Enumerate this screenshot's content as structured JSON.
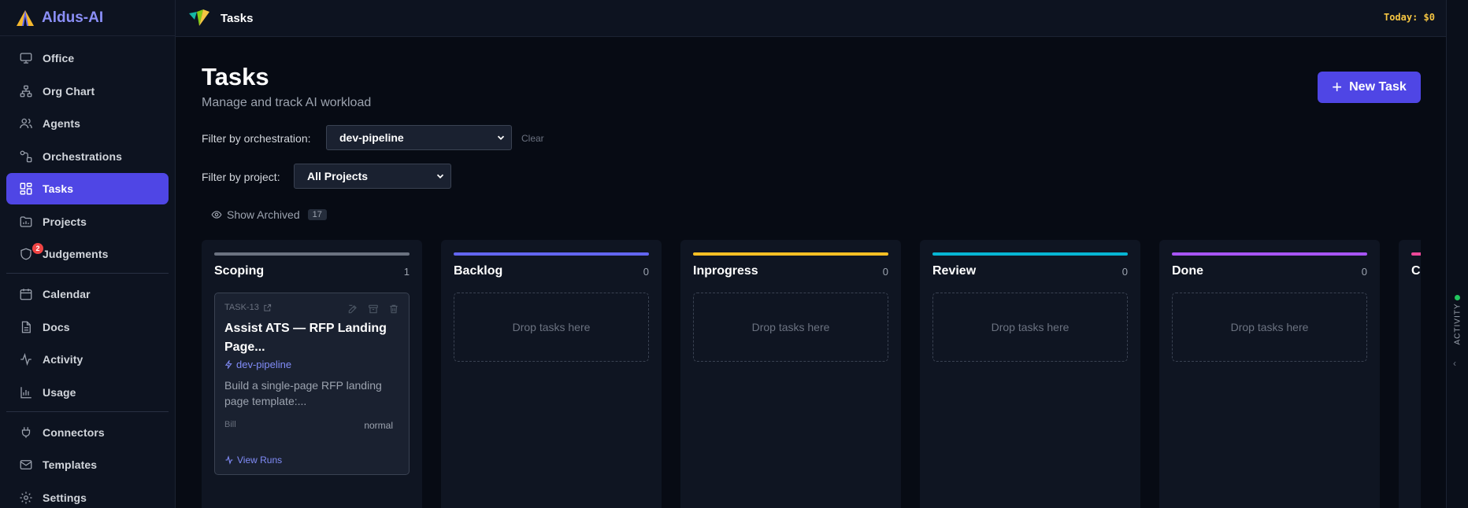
{
  "app": {
    "name": "Aldus-AI"
  },
  "sidebar": {
    "items": [
      {
        "label": "Office",
        "icon": "monitor-icon"
      },
      {
        "label": "Org Chart",
        "icon": "org-chart-icon"
      },
      {
        "label": "Agents",
        "icon": "users-icon"
      },
      {
        "label": "Orchestrations",
        "icon": "workflow-icon"
      },
      {
        "label": "Tasks",
        "icon": "grid-icon",
        "active": true
      },
      {
        "label": "Projects",
        "icon": "folder-chart-icon"
      },
      {
        "label": "Judgements",
        "icon": "shield-icon",
        "badge": "2"
      },
      {
        "label": "Calendar",
        "icon": "calendar-icon"
      },
      {
        "label": "Docs",
        "icon": "document-icon"
      },
      {
        "label": "Activity",
        "icon": "activity-icon"
      },
      {
        "label": "Usage",
        "icon": "bar-chart-icon"
      },
      {
        "label": "Connectors",
        "icon": "plug-icon"
      },
      {
        "label": "Templates",
        "icon": "mail-icon"
      },
      {
        "label": "Settings",
        "icon": "gear-icon"
      }
    ]
  },
  "topbar": {
    "title": "Tasks",
    "today": "Today: $0"
  },
  "page": {
    "title": "Tasks",
    "subtitle": "Manage and track AI workload",
    "new_task_label": "New Task"
  },
  "filters": {
    "orchestration_label": "Filter by orchestration:",
    "orchestration_value": "dev-pipeline",
    "clear_label": "Clear",
    "project_label": "Filter by project:",
    "project_value": "All Projects"
  },
  "archived": {
    "label": "Show Archived",
    "count": "17"
  },
  "columns": [
    {
      "title": "Scoping",
      "count": "1",
      "color": "#6b7280"
    },
    {
      "title": "Backlog",
      "count": "0",
      "color": "#6366f1",
      "empty": "Drop tasks here"
    },
    {
      "title": "Inprogress",
      "count": "0",
      "color": "#fbbf24",
      "empty": "Drop tasks here"
    },
    {
      "title": "Review",
      "count": "0",
      "color": "#06b6d4",
      "empty": "Drop tasks here"
    },
    {
      "title": "Done",
      "count": "0",
      "color": "#a855f7",
      "empty": "Drop tasks here"
    },
    {
      "title": "C",
      "color": "#ec4899"
    }
  ],
  "card": {
    "id": "TASK-13",
    "title": "Assist ATS — RFP Landing Page...",
    "tag": "dev-pipeline",
    "description": "Build a single-page RFP landing page template:...",
    "assignee": "Bill",
    "priority": "normal",
    "runs_label": "View Runs"
  },
  "rail": {
    "label": "ACTIVITY"
  }
}
